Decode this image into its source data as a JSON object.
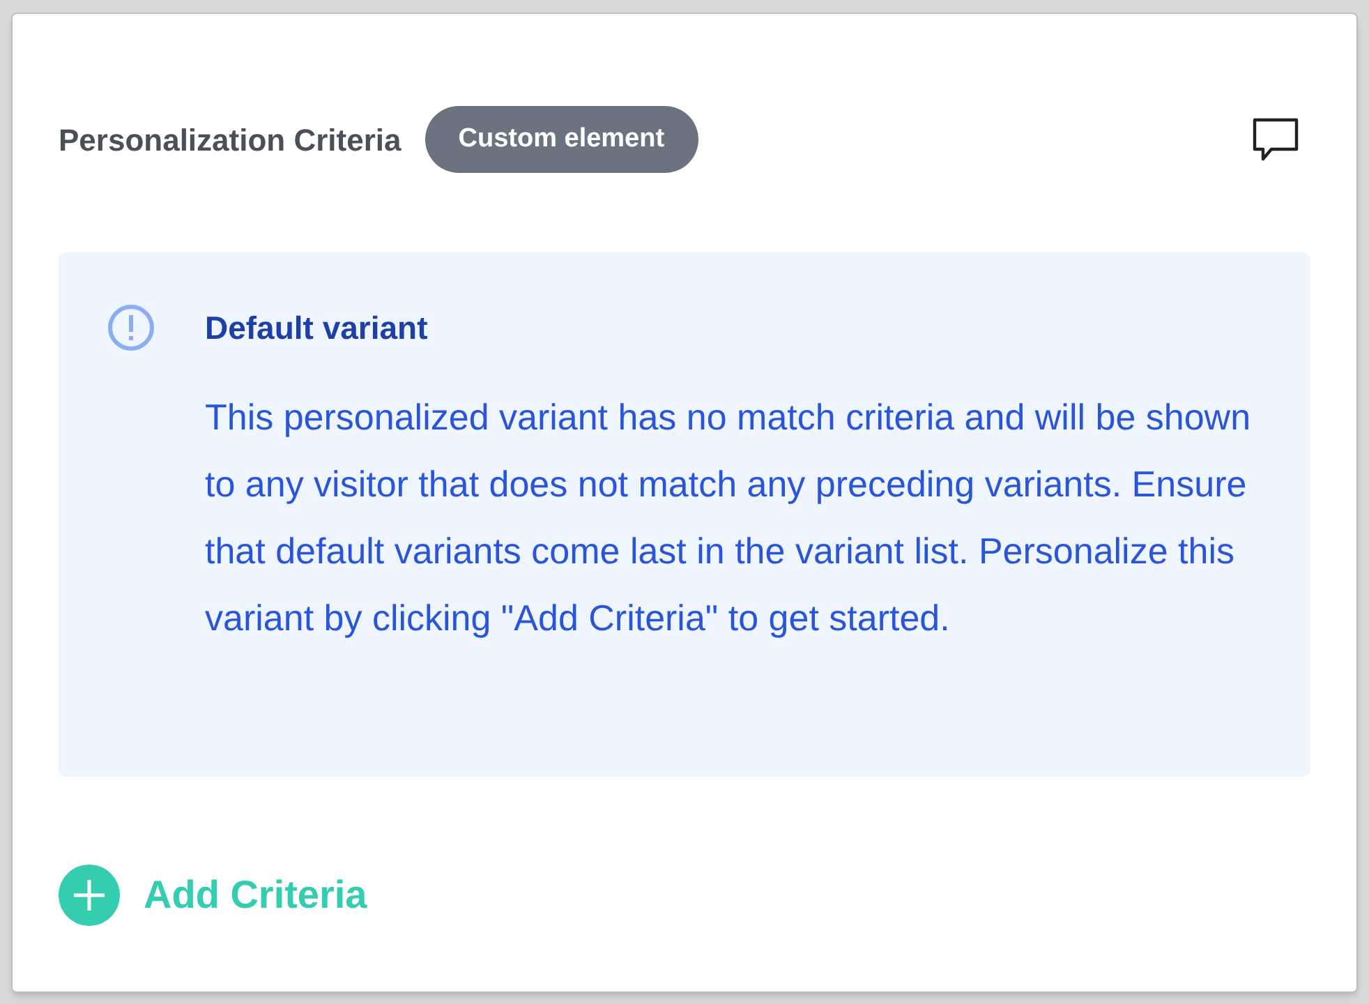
{
  "header": {
    "title": "Personalization Criteria",
    "badge": "Custom element"
  },
  "notice": {
    "title": "Default variant",
    "body": "This personalized variant has no match criteria and will be shown to any visitor that does not match any preceding variants. Ensure that default variants come last in the variant list. Personalize this variant by clicking \"Add Criteria\" to get started."
  },
  "add_button": {
    "label": "Add Criteria"
  }
}
